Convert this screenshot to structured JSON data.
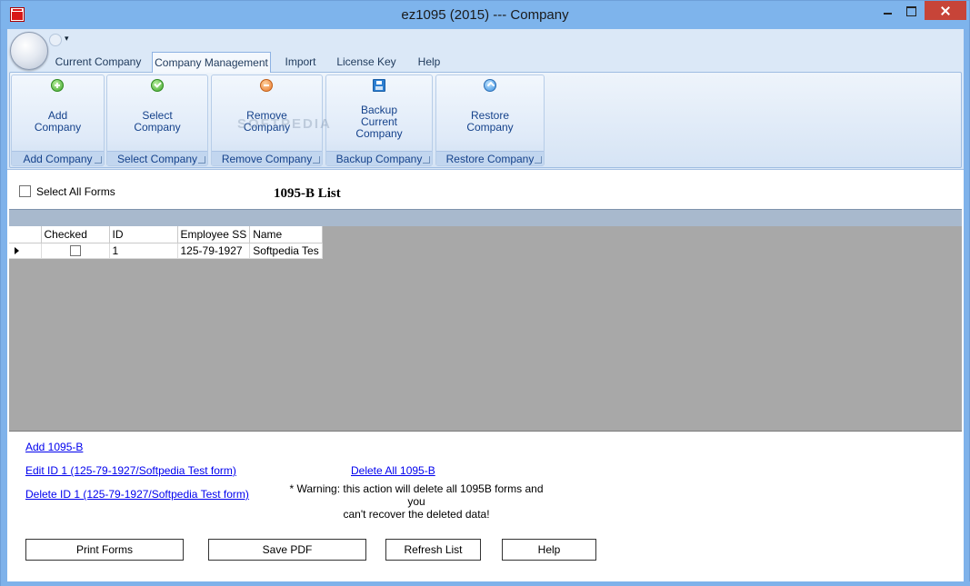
{
  "window": {
    "title": "ez1095 (2015) --- Company"
  },
  "ribbon": {
    "tabs": [
      "Current Company",
      "Company Management",
      "Import",
      "License Key",
      "Help"
    ],
    "active_tab": "Company Management",
    "groups": [
      {
        "button_label": "Add\nCompany",
        "footer": "Add Company",
        "icon": "add-icon"
      },
      {
        "button_label": "Select\nCompany",
        "footer": "Select Company",
        "icon": "check-icon"
      },
      {
        "button_label": "Remove\nCompany",
        "footer": "Remove Company",
        "icon": "remove-icon"
      },
      {
        "button_label": "Backup\nCurrent\nCompany",
        "footer": "Backup Company",
        "icon": "floppy-disk-icon"
      },
      {
        "button_label": "Restore\nCompany",
        "footer": "Restore Company",
        "icon": "restore-icon"
      }
    ],
    "watermark": "SOFTPEDIA"
  },
  "list": {
    "select_all_label": "Select All Forms",
    "title": "1095-B List",
    "columns": [
      "Checked",
      "ID",
      "Employee SS",
      "Name"
    ],
    "rows": [
      {
        "checked": false,
        "id": "1",
        "ssn": "125-79-1927",
        "name": "Softpedia Tes"
      }
    ]
  },
  "links": {
    "add": "Add 1095-B",
    "edit": "Edit ID 1 (125-79-1927/Softpedia Test form)",
    "delete": "Delete ID 1 (125-79-1927/Softpedia Test form)",
    "delete_all": "Delete All 1095-B"
  },
  "warning": {
    "line1": "* Warning: this action will delete all 1095B forms and you",
    "line2": "can't recover the deleted data!"
  },
  "buttons": {
    "print": "Print Forms",
    "save_pdf": "Save PDF",
    "refresh": "Refresh List",
    "help": "Help"
  },
  "colors": {
    "title_bar": "#7eb4ec",
    "close_button": "#c74438",
    "ribbon_text": "#15428b",
    "grid_background": "#a8a8a8",
    "link": "#0000ee"
  }
}
